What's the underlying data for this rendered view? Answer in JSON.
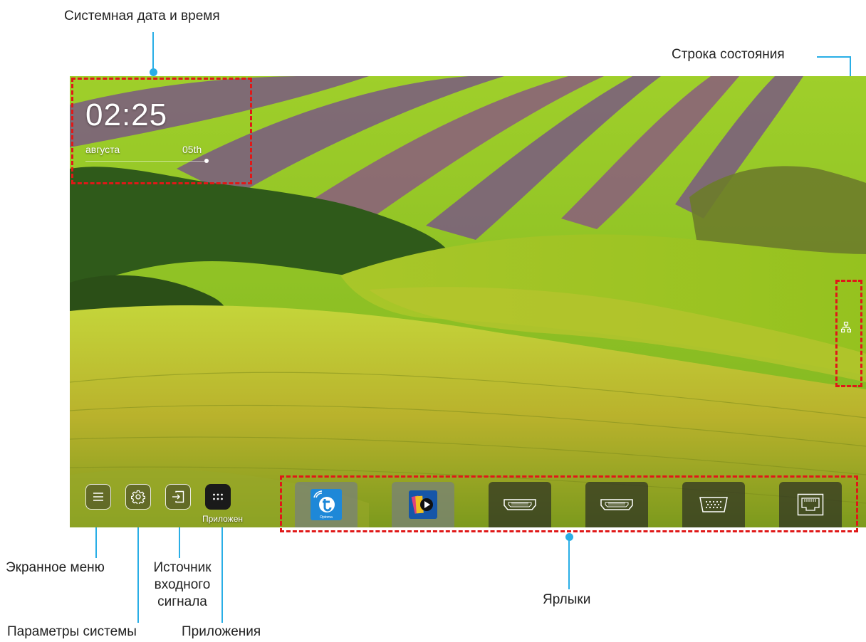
{
  "callouts": {
    "datetime": "Системная дата и время",
    "statusbar": "Строка состояния",
    "osd_menu": "Экранное меню",
    "input_source": "Источник входного сигнала",
    "system_settings": "Параметры системы",
    "apps": "Приложения",
    "shortcuts": "Ярлыки"
  },
  "home": {
    "time": "02:25",
    "month": "августа",
    "day": "05th",
    "status_icons": [
      "ethernet-network-icon"
    ],
    "bottom_buttons": [
      {
        "icon": "menu-icon"
      },
      {
        "icon": "gear-icon"
      },
      {
        "icon": "input-source-icon"
      },
      {
        "icon": "apps-grid-icon",
        "label": "Приложен"
      }
    ],
    "shortcuts": [
      {
        "icon": "optoma-app-icon",
        "small_text": "Optoma"
      },
      {
        "icon": "media-player-app-icon"
      },
      {
        "icon": "hdmi-port-icon"
      },
      {
        "icon": "hdmi-port-icon"
      },
      {
        "icon": "vga-port-icon"
      },
      {
        "icon": "lan-port-icon"
      }
    ]
  },
  "colors": {
    "highlight_dashes": "#e01818",
    "leader_lines": "#29aee6",
    "field_green": "#8cbf22",
    "field_purple": "#7a5a82"
  }
}
